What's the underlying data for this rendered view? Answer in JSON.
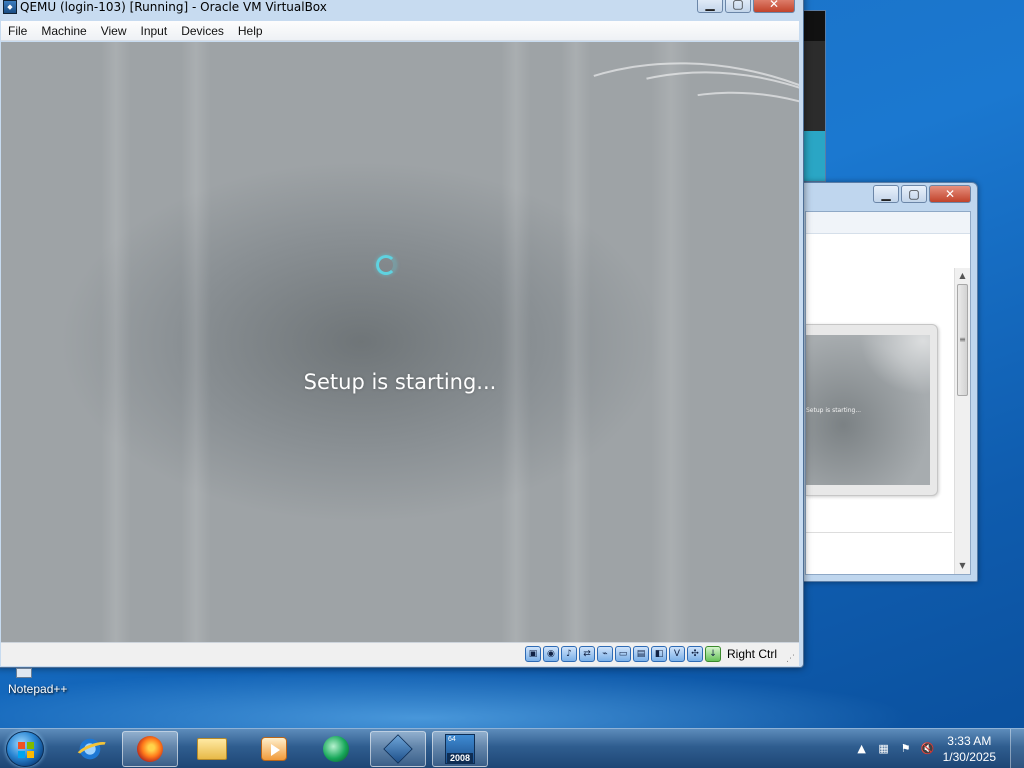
{
  "vm_window": {
    "title": "QEMU (login-103) [Running] - Oracle VM VirtualBox",
    "menu": [
      "File",
      "Machine",
      "View",
      "Input",
      "Devices",
      "Help"
    ],
    "screen_text": "Setup is starting...",
    "host_key": "Right Ctrl"
  },
  "background_window": {
    "thumbnail_text": "Setup is starting..."
  },
  "desktop": {
    "icon_label": "Notepad++"
  },
  "taskbar": {
    "apps": [
      "Internet Explorer",
      "Firefox",
      "Windows Explorer",
      "Media Center",
      "Windows Media Player",
      "Oracle VM VirtualBox",
      "QEMU 2008"
    ],
    "qemu_badge_top": "64",
    "qemu_badge_bottom": "2008",
    "clock_time": "3:33 AM",
    "clock_date": "1/30/2025"
  },
  "colors": {
    "desktop_blue": "#1b78d0",
    "taskbar": "#2f5d8f",
    "spinner": "#5fd2e0"
  }
}
